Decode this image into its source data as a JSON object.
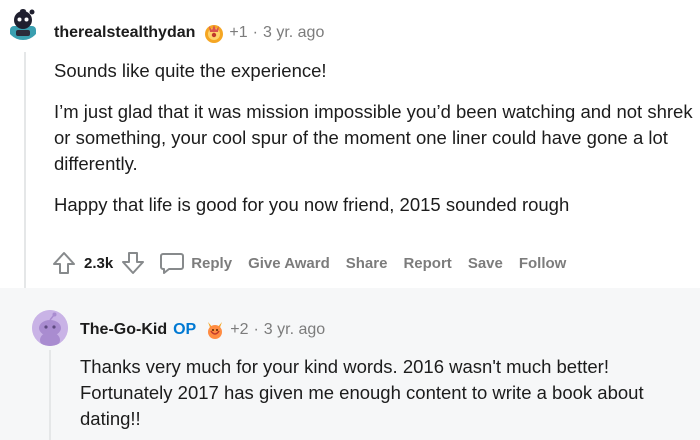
{
  "comment1": {
    "username": "therealstealthydan",
    "award_count": "+1",
    "separator": "·",
    "age": "3 yr. ago",
    "paragraphs": [
      "Sounds like quite the experience!",
      "I’m just glad that it was mission impossible you’d been watching and not shrek or something, your cool spur of the moment one liner could have gone a lot differently.",
      "Happy that life is good for you now friend, 2015 sounded rough"
    ],
    "score": "2.3k",
    "actions": {
      "reply": "Reply",
      "give_award": "Give Award",
      "share": "Share",
      "report": "Report",
      "save": "Save",
      "follow": "Follow"
    }
  },
  "comment2": {
    "username": "The-Go-Kid",
    "op_badge": "OP",
    "award_count": "+2",
    "separator": "·",
    "age": "3 yr. ago",
    "paragraphs": [
      "Thanks very much for your kind words. 2016 wasn't much better! Fortunately 2017 has given me enough content to write a book about dating!!"
    ]
  },
  "colors": {
    "op": "#0079d3",
    "meta": "#7c7c7c",
    "text": "#1c1c1c",
    "reply_bg": "#f6f7f8"
  },
  "icons": {
    "upvote": "arrow-up-icon",
    "downvote": "arrow-down-icon",
    "reply": "speech-bubble-icon",
    "award": "award-icon",
    "avatar": "snoo-avatar"
  }
}
